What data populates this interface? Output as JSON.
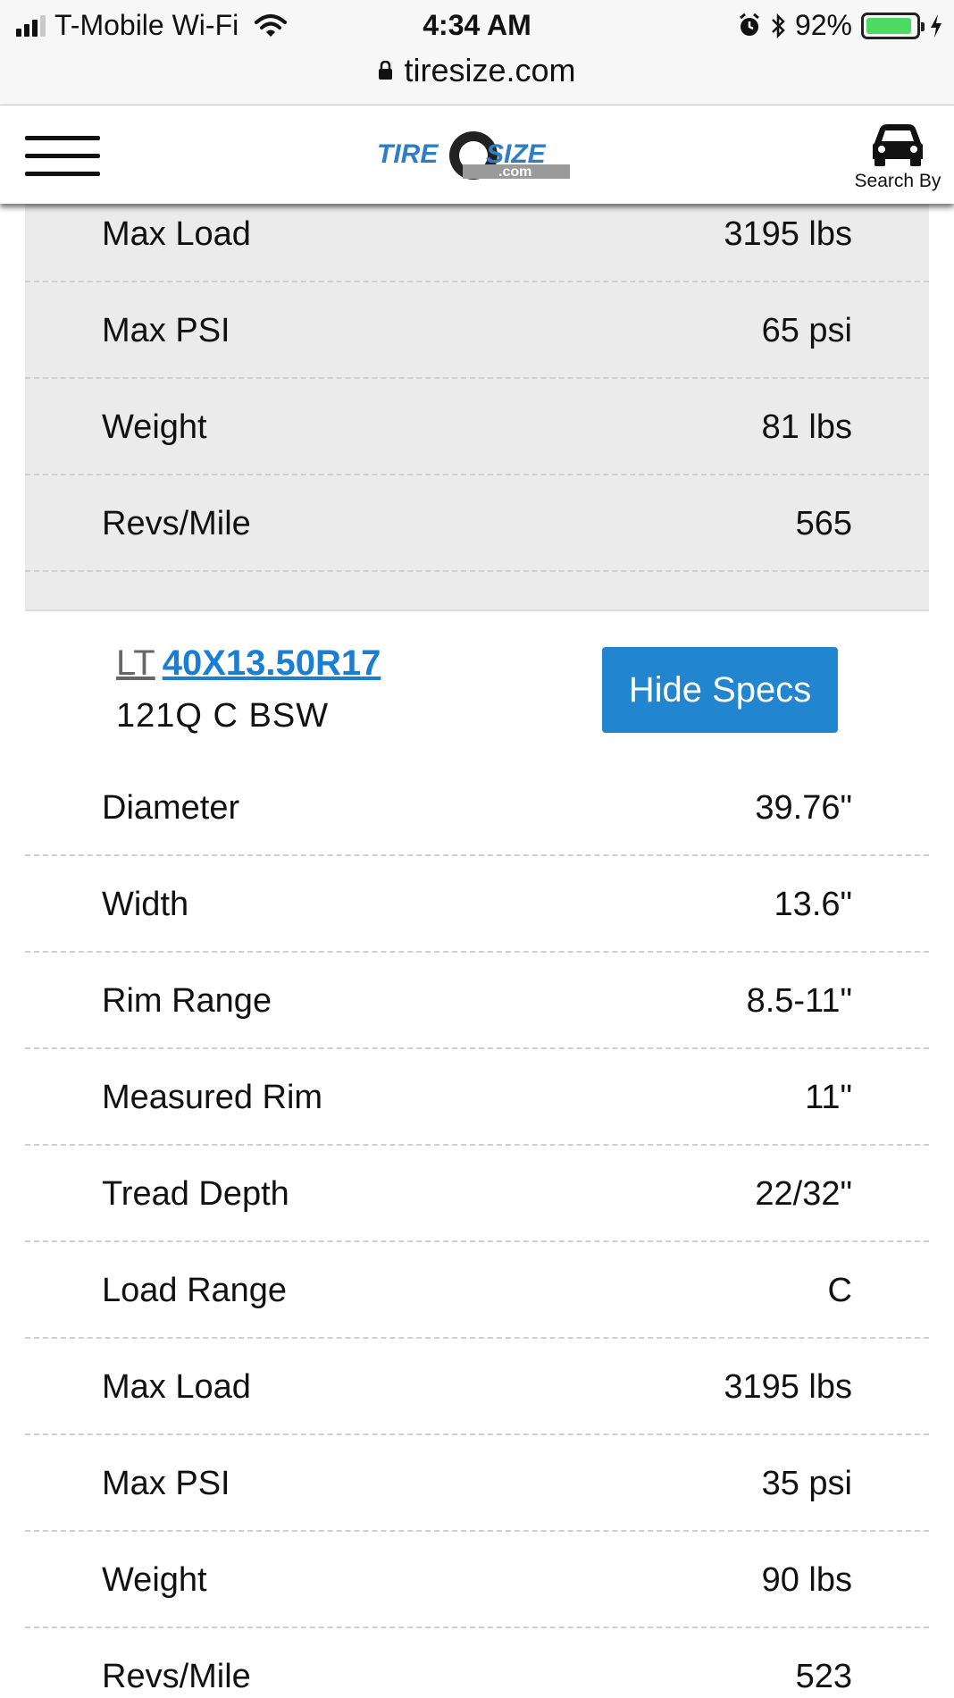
{
  "status_bar": {
    "carrier": "T-Mobile Wi-Fi",
    "time": "4:34 AM",
    "battery_percent": "92%",
    "battery_level": 0.92,
    "battery_color": "#4cd964"
  },
  "browser": {
    "url": "tiresize.com"
  },
  "header": {
    "logo_text_tire": "TIRE",
    "logo_text_size": "SIZE",
    "logo_text_com": ".com",
    "search_by_label": "Search By",
    "brand_blue": "#1a7fd4"
  },
  "previous_tire_specs": [
    {
      "label": "Max Load",
      "value": "3195 lbs"
    },
    {
      "label": "Max PSI",
      "value": "65 psi"
    },
    {
      "label": "Weight",
      "value": "81 lbs"
    },
    {
      "label": "Revs/Mile",
      "value": "565"
    }
  ],
  "tire": {
    "prefix": "LT",
    "size": "40X13.50R17",
    "description": "121Q C BSW",
    "hide_specs_label": "Hide Specs",
    "button_color": "#2185d0"
  },
  "tire_specs": [
    {
      "label": "Diameter",
      "value": "39.76\""
    },
    {
      "label": "Width",
      "value": "13.6\""
    },
    {
      "label": "Rim Range",
      "value": "8.5-11\""
    },
    {
      "label": "Measured Rim",
      "value": "11\""
    },
    {
      "label": "Tread Depth",
      "value": "22/32\""
    },
    {
      "label": "Load Range",
      "value": "C"
    },
    {
      "label": "Max Load",
      "value": "3195 lbs"
    },
    {
      "label": "Max PSI",
      "value": "35 psi"
    },
    {
      "label": "Weight",
      "value": "90 lbs"
    },
    {
      "label": "Revs/Mile",
      "value": "523"
    }
  ]
}
